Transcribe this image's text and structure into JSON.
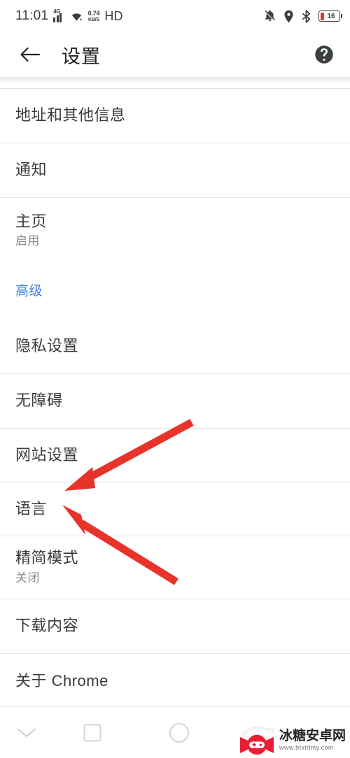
{
  "status_bar": {
    "time": "11:01",
    "network_generation": "4G",
    "signal_icon": "signal-bars-icon",
    "wifi_icon": "wifi-icon",
    "net_speed_value": "0.74",
    "net_speed_unit": "KB/S",
    "hd_label": "HD",
    "notifications_muted_icon": "bell-off-icon",
    "location_icon": "location-pin-icon",
    "bluetooth_icon": "bluetooth-icon",
    "battery_percent": "16",
    "battery_color": "#e8332a"
  },
  "app_bar": {
    "back_icon": "arrow-back-icon",
    "title": "设置",
    "help_icon": "help-circle-icon"
  },
  "settings": {
    "accent_color": "#3b7fe0",
    "items": [
      {
        "title": "地址和其他信息",
        "subtitle": "",
        "type": "item"
      },
      {
        "title": "通知",
        "subtitle": "",
        "type": "item"
      },
      {
        "title": "主页",
        "subtitle": "启用",
        "type": "item"
      },
      {
        "title": "高级",
        "subtitle": "",
        "type": "section"
      },
      {
        "title": "隐私设置",
        "subtitle": "",
        "type": "item"
      },
      {
        "title": "无障碍",
        "subtitle": "",
        "type": "item"
      },
      {
        "title": "网站设置",
        "subtitle": "",
        "type": "item"
      },
      {
        "title": "语言",
        "subtitle": "",
        "type": "item"
      },
      {
        "title": "精简模式",
        "subtitle": "关闭",
        "type": "item"
      },
      {
        "title": "下载内容",
        "subtitle": "",
        "type": "item"
      },
      {
        "title": "关于 Chrome",
        "subtitle": "",
        "type": "item"
      }
    ]
  },
  "annotations": {
    "arrow_color": "#e8332a",
    "arrows": [
      {
        "name": "arrow-pointing-to-languages-top",
        "target": "语言"
      },
      {
        "name": "arrow-pointing-to-languages-bottom",
        "target": "语言"
      }
    ]
  },
  "nav_bar": {
    "back_icon": "chevron-down-icon",
    "recents_icon": "square-icon",
    "home_icon": "circle-icon"
  },
  "watermark": {
    "name": "冰糖安卓网",
    "url": "www.btxtdmy.com",
    "logo_icon": "candy-ninja-logo-icon",
    "color": "#e8172e"
  }
}
